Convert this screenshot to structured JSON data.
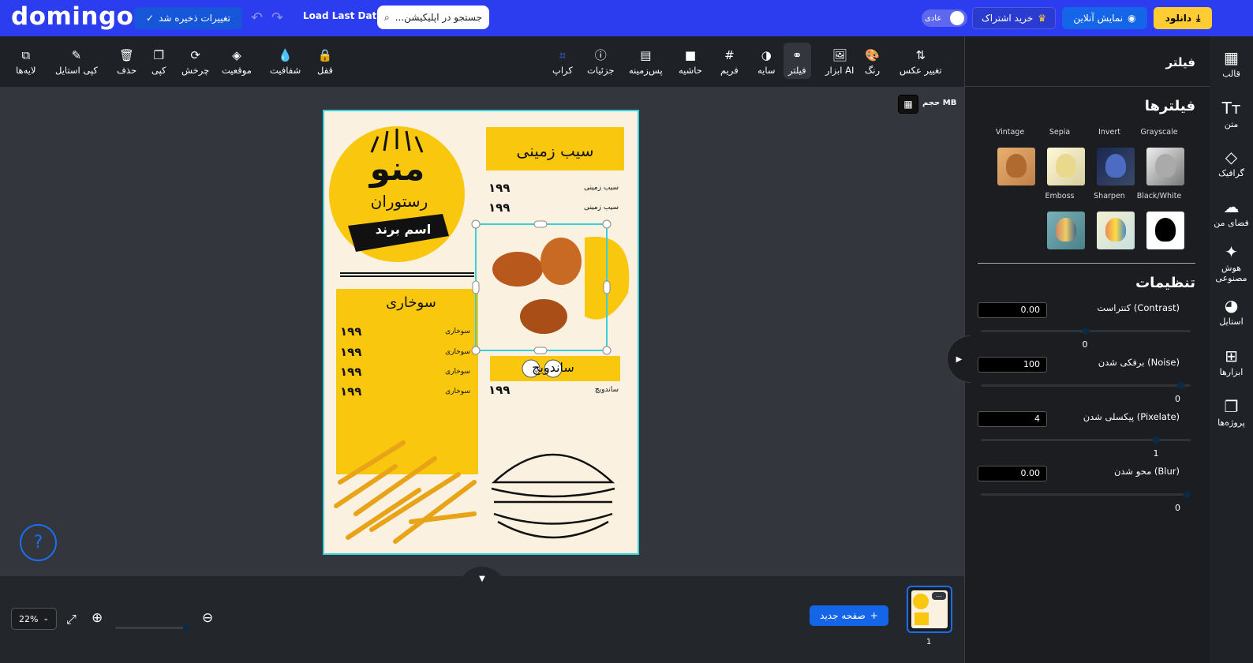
{
  "header": {
    "logo": "domingo",
    "saved_label": "تغییرات ذخیره شد",
    "load_last": "Load Last Data",
    "search_placeholder": "جستجو در اپلیکیشن...",
    "mode_label": "عادی",
    "buy_label": "خرید اشتراک",
    "online_label": "نمایش آنلاین",
    "download_label": "دانلود"
  },
  "toolbar": {
    "items": [
      {
        "label": "لایه‌ها",
        "icon": "layers-icon"
      },
      {
        "label": "کپی استایل",
        "icon": "brush-icon"
      },
      {
        "label": "حذف",
        "icon": "trash-icon"
      },
      {
        "label": "کپی",
        "icon": "copy-icon"
      },
      {
        "label": "چرخش",
        "icon": "rotate-icon"
      },
      {
        "label": "موقعیت",
        "icon": "stack-icon"
      },
      {
        "label": "شفافیت",
        "icon": "drop-icon"
      },
      {
        "label": "قفل",
        "icon": "lock-icon"
      },
      {
        "label": "کراپ",
        "icon": "crop-icon"
      },
      {
        "label": "جزئیات",
        "icon": "info-icon"
      },
      {
        "label": "پس‌زمینه",
        "icon": "background-icon"
      },
      {
        "label": "حاشیه",
        "icon": "border-icon"
      },
      {
        "label": "فریم",
        "icon": "frame-icon"
      },
      {
        "label": "سایه",
        "icon": "shadow-icon"
      },
      {
        "label": "فیلتر",
        "icon": "filter-icon"
      },
      {
        "label": "ابزار AI",
        "icon": "ai-tool-icon"
      },
      {
        "label": "رنگ",
        "icon": "palette-icon"
      },
      {
        "label": "تغییر عکس",
        "icon": "swap-image-icon"
      }
    ]
  },
  "canvas": {
    "size_label": "حجم MB",
    "zoom": "22%",
    "new_page": "صفحه جدید",
    "page_number": "1"
  },
  "poster": {
    "title_big": "منو",
    "title_sub": "رستوران",
    "brand": "اسم برند",
    "section1": "سیب زمینی",
    "section2": "سوخاری",
    "section3": "ساندویچ",
    "item1": "سیب زمینی",
    "item2": "سوخاری",
    "item3": "ساندویچ",
    "price": "۱۹۹"
  },
  "panel": {
    "title": "فیلتر",
    "filters_heading": "فیلترها",
    "filters": [
      "Grayscale",
      "Invert",
      "Sepia",
      "Vintage",
      "Black/White",
      "Sharpen",
      "Emboss"
    ],
    "settings_heading": "تنظیمات",
    "settings": [
      {
        "label": "کنتراست (Contrast)",
        "value": "0.00",
        "slider_value": "0",
        "level": 0.5
      },
      {
        "label": "برفکی شدن (Noise)",
        "value": "100",
        "slider_value": "0",
        "level": 0.97
      },
      {
        "label": "پیکسلی شدن (Pixelate)",
        "value": "4",
        "slider_value": "1",
        "level": 0.85
      },
      {
        "label": "محو شدن (Blur)",
        "value": "0.00",
        "slider_value": "0",
        "level": 1.0
      }
    ]
  },
  "rightbar": {
    "items": [
      {
        "label": "قالب",
        "icon": "template-icon"
      },
      {
        "label": "متن",
        "icon": "text-icon"
      },
      {
        "label": "گرافیک",
        "icon": "graphics-icon"
      },
      {
        "label": "فضای من",
        "icon": "cloud-upload-icon"
      },
      {
        "label": "هوش مصنوعی",
        "icon": "magic-wand-icon"
      },
      {
        "label": "استایل",
        "icon": "palette-icon"
      },
      {
        "label": "ابزارها",
        "icon": "grid-plus-icon"
      },
      {
        "label": "پروژه‌ها",
        "icon": "projects-icon"
      }
    ]
  },
  "colors": {
    "accent": "#2c3cef",
    "download": "#ffcc33",
    "poster_yellow": "#f9c80e",
    "selection": "#3ad0d8"
  }
}
